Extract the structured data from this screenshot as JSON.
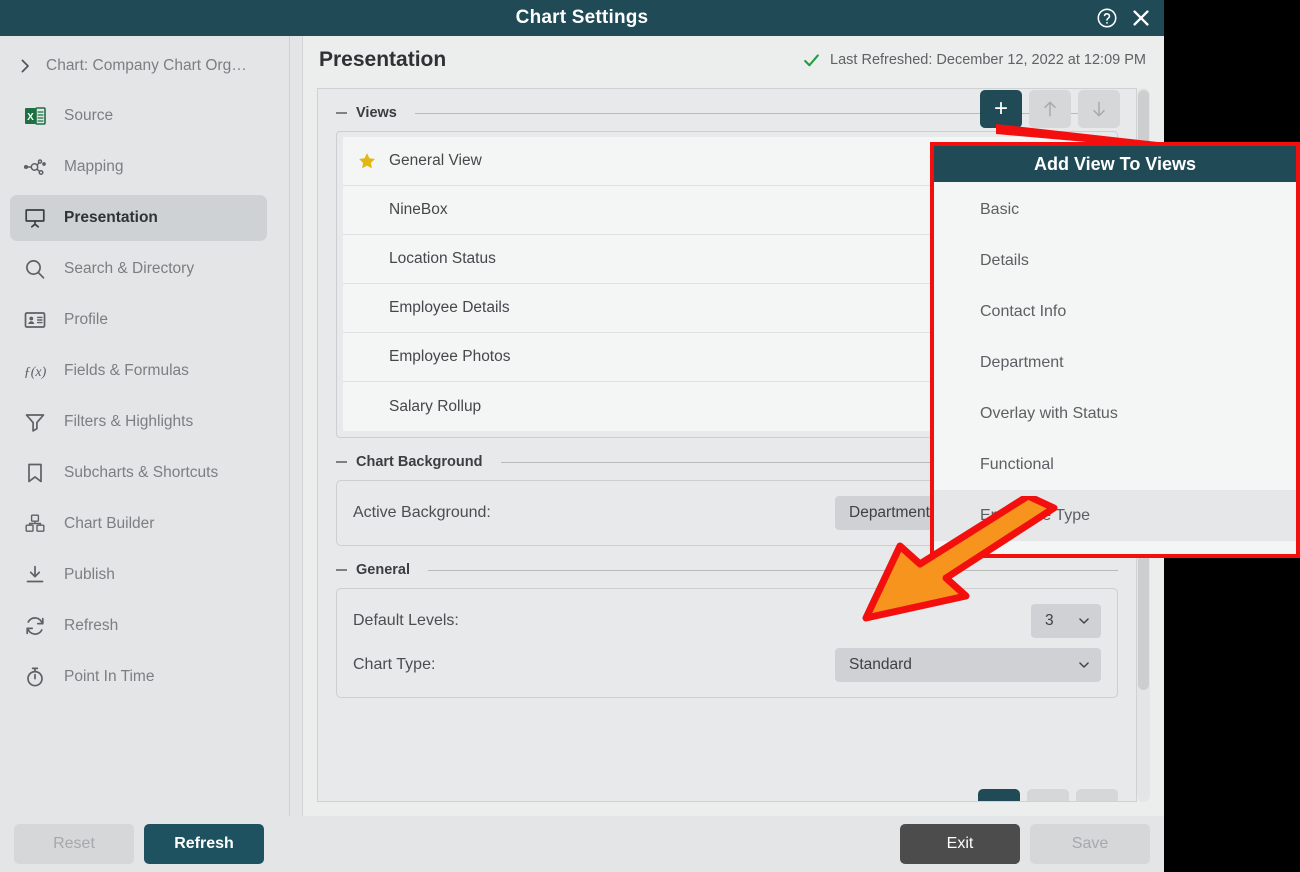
{
  "window": {
    "title": "Chart Settings",
    "help_icon": "help-circle-icon",
    "close_icon": "close-icon"
  },
  "sidebar": {
    "breadcrumb": {
      "icon": "chevron-right-icon",
      "label": "Chart: Company Chart Org…"
    },
    "items": [
      {
        "label": "Source",
        "icon": "excel-file-icon",
        "active": false
      },
      {
        "label": "Mapping",
        "icon": "node-mapping-icon",
        "active": false
      },
      {
        "label": "Presentation",
        "icon": "presentation-icon",
        "active": true
      },
      {
        "label": "Search & Directory",
        "icon": "search-icon",
        "active": false
      },
      {
        "label": "Profile",
        "icon": "id-card-icon",
        "active": false
      },
      {
        "label": "Fields & Formulas",
        "icon": "function-icon",
        "active": false
      },
      {
        "label": "Filters & Highlights",
        "icon": "funnel-icon",
        "active": false
      },
      {
        "label": "Subcharts & Shortcuts",
        "icon": "bookmark-icon",
        "active": false
      },
      {
        "label": "Chart Builder",
        "icon": "blocks-icon",
        "active": false
      },
      {
        "label": "Publish",
        "icon": "download-icon",
        "active": false
      },
      {
        "label": "Refresh",
        "icon": "refresh-icon",
        "active": false
      },
      {
        "label": "Point In Time",
        "icon": "stopwatch-icon",
        "active": false
      }
    ]
  },
  "main": {
    "title": "Presentation",
    "status": {
      "icon": "check-icon",
      "text": "Last Refreshed: December 12, 2022 at 12:09 PM",
      "color": "#1f9d3c"
    },
    "views_group": {
      "legend": "Views",
      "toolbar": [
        {
          "name": "add-view-button",
          "glyph": "+",
          "state": "primary"
        },
        {
          "name": "move-view-up-button",
          "glyph": "↑",
          "state": "disabled"
        },
        {
          "name": "move-view-down-button",
          "glyph": "↓",
          "state": "disabled"
        }
      ],
      "rows": [
        {
          "label": "General View",
          "starred": true
        },
        {
          "label": "NineBox",
          "starred": false
        },
        {
          "label": "Location Status",
          "starred": false
        },
        {
          "label": "Employee Details",
          "starred": false
        },
        {
          "label": "Employee Photos",
          "starred": false
        },
        {
          "label": "Salary Rollup",
          "starred": false
        }
      ]
    },
    "chart_background_group": {
      "legend": "Chart Background",
      "fields": [
        {
          "label": "Active Background:",
          "value": "Department Count",
          "size": "wide"
        }
      ]
    },
    "general_group": {
      "legend": "General",
      "fields": [
        {
          "label": "Default Levels:",
          "value": "3",
          "size": "narrow"
        },
        {
          "label": "Chart Type:",
          "value": "Standard",
          "size": "wide"
        }
      ]
    }
  },
  "popup": {
    "title": "Add View To Views",
    "border_color": "#f40f0f",
    "header_color": "#1f4a56",
    "items": [
      {
        "label": "Basic",
        "highlighted": false
      },
      {
        "label": "Details",
        "highlighted": false
      },
      {
        "label": "Contact Info",
        "highlighted": false
      },
      {
        "label": "Department",
        "highlighted": false
      },
      {
        "label": "Overlay with Status",
        "highlighted": false
      },
      {
        "label": "Functional",
        "highlighted": false
      },
      {
        "label": "Employee Type",
        "highlighted": true
      }
    ]
  },
  "annotation": {
    "arrow_icon": "orange-arrow-annotation",
    "fill": "#F7941E",
    "stroke": "#F40F0F"
  },
  "footer": {
    "reset_label": "Reset",
    "refresh_label": "Refresh",
    "exit_label": "Exit",
    "save_label": "Save"
  }
}
